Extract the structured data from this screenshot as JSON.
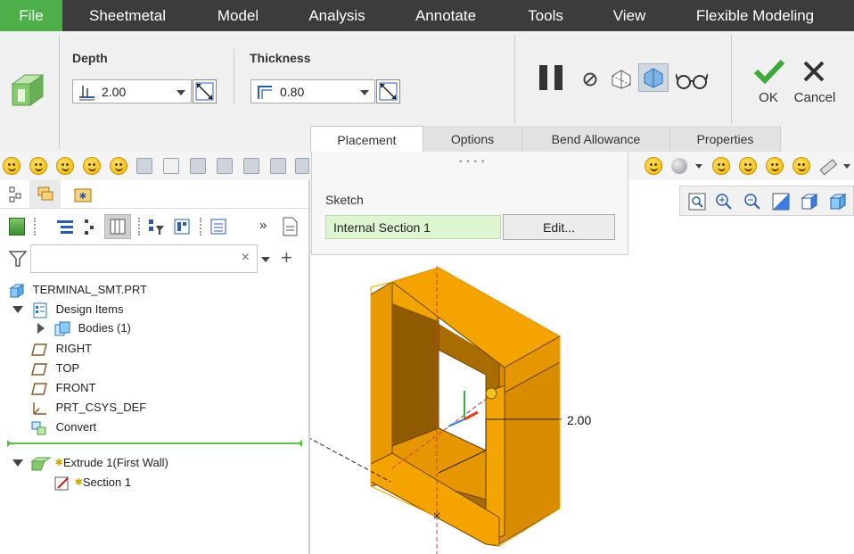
{
  "menu": {
    "items": [
      "File",
      "Sheetmetal",
      "Model",
      "Analysis",
      "Annotate",
      "Tools",
      "View",
      "Flexible Modeling"
    ]
  },
  "dashboard": {
    "depth_label": "Depth",
    "depth_value": "2.00",
    "thickness_label": "Thickness",
    "thickness_value": "0.80",
    "ok_label": "OK",
    "cancel_label": "Cancel"
  },
  "tabs": [
    "Placement",
    "Options",
    "Bend Allowance",
    "Properties"
  ],
  "placement": {
    "sketch_label": "Sketch",
    "sketch_value": "Internal Section 1",
    "edit_label": "Edit..."
  },
  "filter": {
    "value": ""
  },
  "tree": {
    "root": "TERMINAL_SMT.PRT",
    "design_items": "Design Items",
    "bodies": "Bodies (1)",
    "right": "RIGHT",
    "top": "TOP",
    "front": "FRONT",
    "csys": "PRT_CSYS_DEF",
    "convert": "Convert",
    "extrude": "Extrude 1(First Wall)",
    "section": "Section 1"
  },
  "graphics": {
    "dimension_value": "2.00"
  },
  "colors": {
    "menubar": "#3c3c3c",
    "file_active": "#4daf4a",
    "part_orange": "#f5a300",
    "sketch_field": "#ddf5d0"
  }
}
